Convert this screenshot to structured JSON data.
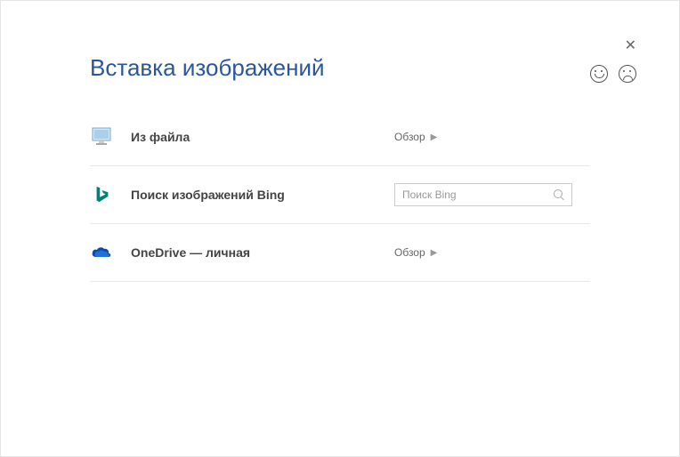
{
  "title": "Вставка изображений",
  "options": {
    "file": {
      "label": "Из файла",
      "action": "Обзор"
    },
    "bing": {
      "label": "Поиск изображений Bing",
      "placeholder": "Поиск Bing"
    },
    "onedrive": {
      "label": "OneDrive — личная",
      "action": "Обзор"
    }
  }
}
